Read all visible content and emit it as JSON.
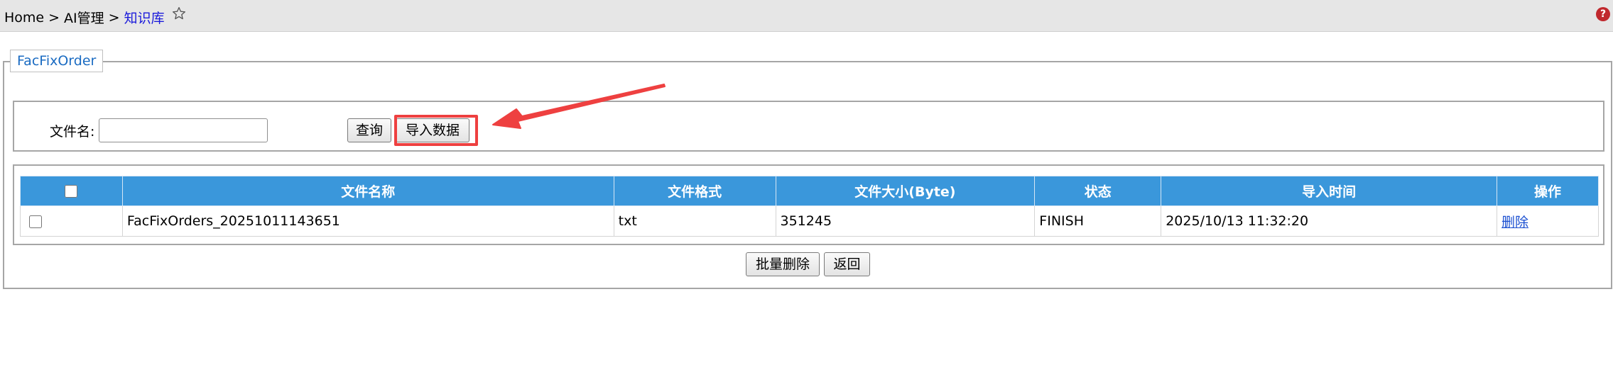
{
  "breadcrumb": {
    "home": "Home",
    "separator": ">",
    "level2": "AI管理",
    "current": "知识库"
  },
  "header": {
    "help_icon_glyph": "?"
  },
  "panel": {
    "legend": "FacFixOrder"
  },
  "search": {
    "filename_label": "文件名:",
    "filename_value": "",
    "filename_placeholder": "",
    "query_label": "查询",
    "import_label": "导入数据"
  },
  "table": {
    "columns": [
      "文件名称",
      "文件格式",
      "文件大小(Byte)",
      "状态",
      "导入时间",
      "操作"
    ],
    "rows": [
      {
        "file_name": "FacFixOrders_20251011143651",
        "format": "txt",
        "size": "351245",
        "status": "FINISH",
        "import_time": "2025/10/13 11:32:20",
        "action": "删除"
      }
    ]
  },
  "footer": {
    "batch_delete_label": "批量删除",
    "back_label": "返回"
  },
  "colors": {
    "header_blue": "#3a97db",
    "annotation_red": "#ee4040",
    "link_blue": "#1a4fd1",
    "breadcrumb_current": "#1a1adb"
  },
  "icons": [
    "star-icon",
    "help-icon",
    "arrow-annotation"
  ]
}
